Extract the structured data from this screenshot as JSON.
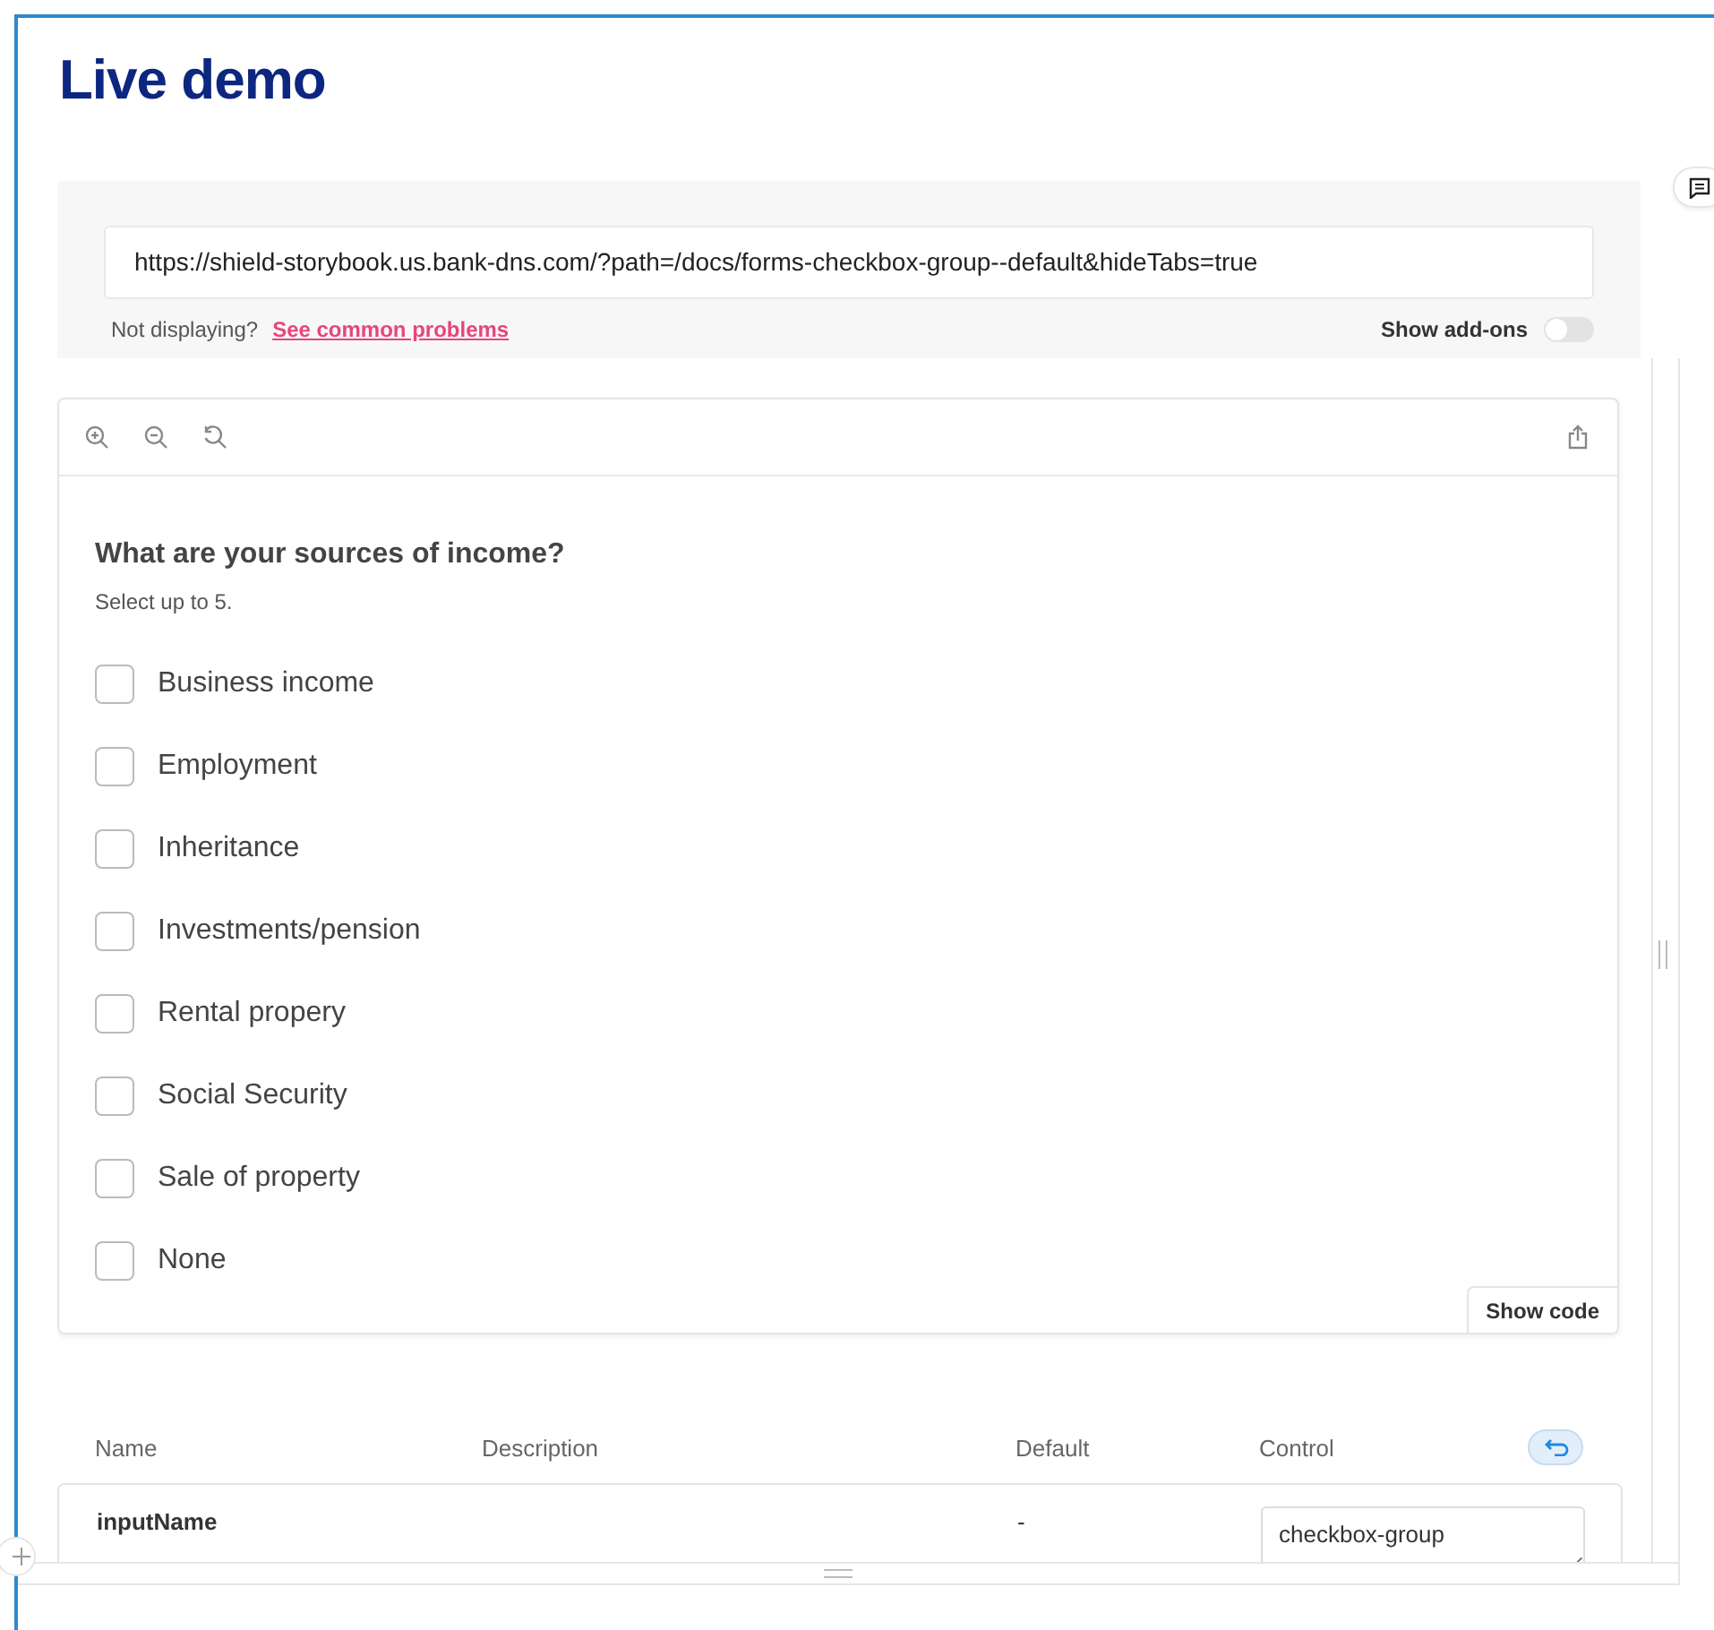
{
  "heading": "Live demo",
  "embed": {
    "url": "https://shield-storybook.us.bank-dns.com/?path=/docs/forms-checkbox-group--default&hideTabs=true",
    "help_text": "Not displaying?",
    "help_link": "See common problems",
    "addons_label": "Show add-ons",
    "addons_on": false
  },
  "preview": {
    "question": "What are your sources of income?",
    "hint": "Select up to 5.",
    "options": [
      {
        "label": "Business income",
        "checked": false
      },
      {
        "label": "Employment",
        "checked": false
      },
      {
        "label": "Inheritance",
        "checked": false
      },
      {
        "label": "Investments/pension",
        "checked": false
      },
      {
        "label": "Rental propery",
        "checked": false
      },
      {
        "label": "Social Security",
        "checked": false
      },
      {
        "label": "Sale of property",
        "checked": false
      },
      {
        "label": "None",
        "checked": false
      }
    ],
    "show_code": "Show code"
  },
  "args_table": {
    "columns": [
      "Name",
      "Description",
      "Default",
      "Control"
    ],
    "rows": [
      {
        "name": "inputName",
        "default": "-",
        "control_value": "checkbox-group"
      }
    ]
  }
}
